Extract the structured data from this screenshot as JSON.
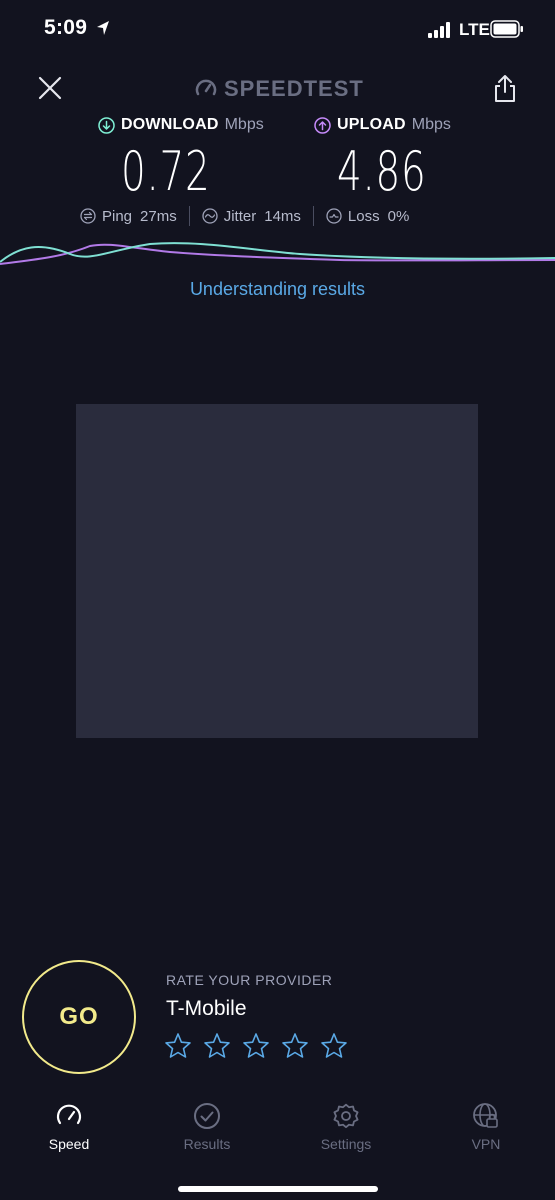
{
  "status_bar": {
    "time": "5:09",
    "network": "LTE"
  },
  "header": {
    "logo_text": "SPEEDTEST"
  },
  "download": {
    "label": "DOWNLOAD",
    "unit": "Mbps",
    "value": "0.72",
    "color": "#7ff0d5"
  },
  "upload": {
    "label": "UPLOAD",
    "unit": "Mbps",
    "value": "4.86",
    "color": "#c58af9"
  },
  "stats": {
    "ping": {
      "label": "Ping",
      "value": "27",
      "unit": "ms"
    },
    "jitter": {
      "label": "Jitter",
      "value": "14",
      "unit": "ms"
    },
    "loss": {
      "label": "Loss",
      "value": "0",
      "unit": "%"
    }
  },
  "link": {
    "understanding": "Understanding results"
  },
  "rate": {
    "title": "RATE YOUR PROVIDER",
    "provider": "T-Mobile",
    "stars": 5,
    "selected": 0
  },
  "go_button": {
    "label": "GO"
  },
  "tabs": [
    {
      "label": "Speed",
      "icon": "speedometer-icon",
      "active": true
    },
    {
      "label": "Results",
      "icon": "check-circle-icon",
      "active": false
    },
    {
      "label": "Settings",
      "icon": "gear-icon",
      "active": false
    },
    {
      "label": "VPN",
      "icon": "globe-lock-icon",
      "active": false
    }
  ],
  "colors": {
    "background": "#12131f",
    "accent_link": "#5aa9e6",
    "go": "#f2ea8b",
    "star": "#5aa9e6",
    "tab_active": "#ffffff",
    "tab_inactive": "#6a6e82"
  }
}
